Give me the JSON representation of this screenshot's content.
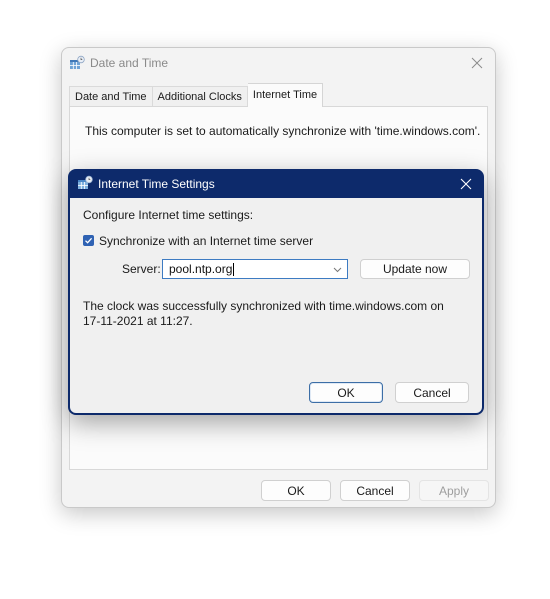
{
  "outer_dialog": {
    "title": "Date and Time",
    "icon": "date-time-control-panel-icon",
    "close_icon": "close-icon",
    "tabs": [
      {
        "label": "Date and Time",
        "active": false
      },
      {
        "label": "Additional Clocks",
        "active": false
      },
      {
        "label": "Internet Time",
        "active": true
      }
    ],
    "message": "This computer is set to automatically synchronize with 'time.windows.com'.",
    "buttons": {
      "ok": "OK",
      "cancel": "Cancel",
      "apply": "Apply"
    }
  },
  "inner_dialog": {
    "title": "Internet Time Settings",
    "icon": "date-time-control-panel-icon",
    "close_icon": "close-icon",
    "heading": "Configure Internet time settings:",
    "sync_checkbox": {
      "label": "Synchronize with an Internet time server",
      "checked": true
    },
    "server_label": "Server:",
    "server_value": "pool.ntp.org",
    "update_button": "Update now",
    "status_line1": "The clock was successfully synchronized with time.windows.com on",
    "status_line2": "17-11-2021 at 11:27.",
    "buttons": {
      "ok": "OK",
      "cancel": "Cancel"
    }
  },
  "colors": {
    "inner_titlebar": "#0d2a6b",
    "accent": "#2f62b3"
  }
}
